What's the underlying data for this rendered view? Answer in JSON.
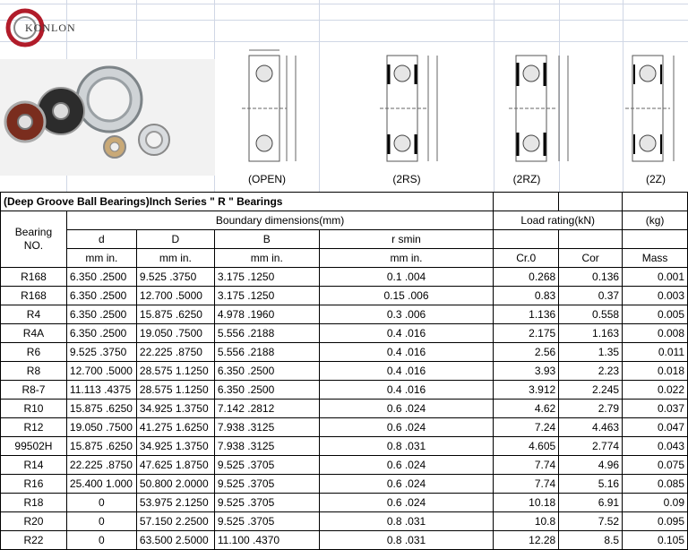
{
  "brand": {
    "logo_text": "KONLON"
  },
  "captions": {
    "open": "(OPEN)",
    "2rs": "(2RS)",
    "2rz": "(2RZ)",
    "2z": "(2Z)"
  },
  "table": {
    "title": "(Deep Groove Ball Bearings)Inch Series \" R \" Bearings",
    "group_boundary": "Boundary dimensions(mm)",
    "group_load": "Load rating(kN)",
    "group_kg": "(kg)",
    "bearing_label_1": "Bearing",
    "bearing_label_2": "NO.",
    "sub_d": "d",
    "sub_D": "D",
    "sub_B": "B",
    "sub_rsmin": "r smin",
    "unit_d": "mm  in.",
    "unit_D": "mm  in.",
    "unit_B": "mm  in.",
    "unit_r": "mm  in.",
    "col_cr0": "Cr.0",
    "col_cor": "Cor",
    "col_mass": "Mass",
    "rows": [
      {
        "no": "R168",
        "d": "6.350  .2500",
        "D": "9.525  .3750",
        "B": "3.175  .1250",
        "r": "0.1  .004",
        "cr0": "0.268",
        "cor": "0.136",
        "mass": "0.001"
      },
      {
        "no": "R168",
        "d": "6.350  .2500",
        "D": "12.700  .5000",
        "B": "3.175  .1250",
        "r": "0.15  .006",
        "cr0": "0.83",
        "cor": "0.37",
        "mass": "0.003"
      },
      {
        "no": "R4",
        "d": "6.350  .2500",
        "D": "15.875  .6250",
        "B": "4.978  .1960",
        "r": "0.3  .006",
        "cr0": "1.136",
        "cor": "0.558",
        "mass": "0.005"
      },
      {
        "no": "R4A",
        "d": "6.350  .2500",
        "D": "19.050  .7500",
        "B": "5.556  .2188",
        "r": "0.4  .016",
        "cr0": "2.175",
        "cor": "1.163",
        "mass": "0.008"
      },
      {
        "no": "R6",
        "d": "9.525  .3750",
        "D": "22.225  .8750",
        "B": "5.556  .2188",
        "r": "0.4  .016",
        "cr0": "2.56",
        "cor": "1.35",
        "mass": "0.011"
      },
      {
        "no": "R8",
        "d": "12.700  .5000",
        "D": "28.575  1.1250",
        "B": "6.350  .2500",
        "r": "0.4  .016",
        "cr0": "3.93",
        "cor": "2.23",
        "mass": "0.018"
      },
      {
        "no": "R8-7",
        "d": "11.113  .4375",
        "D": "28.575  1.1250",
        "B": "6.350  .2500",
        "r": "0.4  .016",
        "cr0": "3.912",
        "cor": "2.245",
        "mass": "0.022"
      },
      {
        "no": "R10",
        "d": "15.875  .6250",
        "D": "34.925  1.3750",
        "B": "7.142  .2812",
        "r": "0.6  .024",
        "cr0": "4.62",
        "cor": "2.79",
        "mass": "0.037"
      },
      {
        "no": "R12",
        "d": "19.050  .7500",
        "D": "41.275  1.6250",
        "B": "7.938  .3125",
        "r": "0.6  .024",
        "cr0": "7.24",
        "cor": "4.463",
        "mass": "0.047"
      },
      {
        "no": "99502H",
        "d": "15.875  .6250",
        "D": "34.925  1.3750",
        "B": "7.938  .3125",
        "r": "0.8  .031",
        "cr0": "4.605",
        "cor": "2.774",
        "mass": "0.043"
      },
      {
        "no": "R14",
        "d": "22.225  .8750",
        "D": "47.625  1.8750",
        "B": "9.525  .3705",
        "r": "0.6  .024",
        "cr0": "7.74",
        "cor": "4.96",
        "mass": "0.075"
      },
      {
        "no": "R16",
        "d": "25.400  1.000",
        "D": "50.800  2.0000",
        "B": "9.525  .3705",
        "r": "0.6  .024",
        "cr0": "7.74",
        "cor": "5.16",
        "mass": "0.085"
      },
      {
        "no": "R18",
        "d": "0",
        "D": "53.975  2.1250",
        "B": "9.525  .3705",
        "r": "0.6  .024",
        "cr0": "10.18",
        "cor": "6.91",
        "mass": "0.09"
      },
      {
        "no": "R20",
        "d": "0",
        "D": "57.150  2.2500",
        "B": "9.525  .3705",
        "r": "0.8  .031",
        "cr0": "10.8",
        "cor": "7.52",
        "mass": "0.095"
      },
      {
        "no": "R22",
        "d": "0",
        "D": "63.500  2.5000",
        "B": "11.100  .4370",
        "r": "0.8  .031",
        "cr0": "12.28",
        "cor": "8.5",
        "mass": "0.105"
      }
    ]
  }
}
